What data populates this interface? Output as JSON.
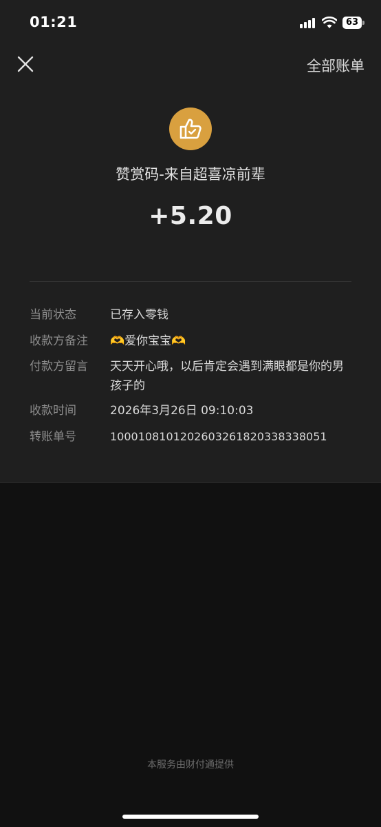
{
  "status_bar": {
    "time": "01:21",
    "battery": "63"
  },
  "header": {
    "all_bills": "全部账单"
  },
  "main": {
    "icon": "thumbs-up-icon",
    "title": "赞赏码-来自超喜凉前辈",
    "amount": "+5.20"
  },
  "details": {
    "status_label": "当前状态",
    "status_value": "已存入零钱",
    "payee_note_label": "收款方备注",
    "payee_note_value": "🫶爱你宝宝🫶",
    "payer_msg_label": "付款方留言",
    "payer_msg_value": "天天开心哦，以后肯定会遇到满眼都是你的男孩子的",
    "time_label": "收款时间",
    "time_value": "2026年3月26日 09:10:03",
    "transfer_no_label": "转账单号",
    "transfer_no_value": "100010810120260326182033833805​1"
  },
  "footer": {
    "provider": "本服务由财付通提供"
  },
  "colors": {
    "badge": "#d9a03f",
    "background": "#111111",
    "card": "#1f1f1f"
  }
}
